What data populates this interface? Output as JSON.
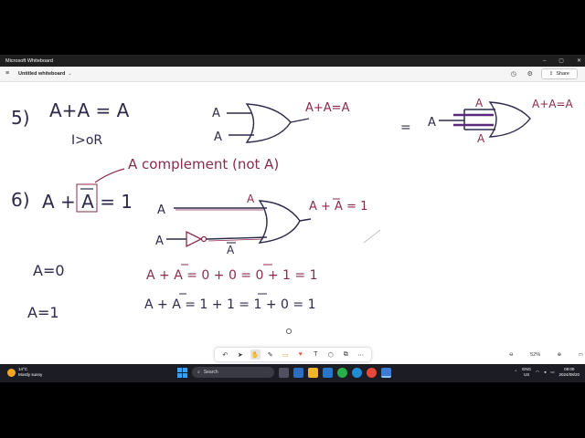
{
  "window": {
    "title": "Microsoft Whiteboard",
    "minimize": "–",
    "maximize": "▢",
    "close": "✕"
  },
  "appbar": {
    "menu": "≡",
    "doc_title": "Untitled whiteboard",
    "chevron": "⌄",
    "history_icon": "◷",
    "settings_icon": "⚙",
    "share_label": "Share",
    "share_icon": "⇪"
  },
  "whiteboard": {
    "eq5_number": "5)",
    "eq5_lhs": "A+A = A",
    "eq5_note": "I>oR",
    "eq5_gate_in1": "A",
    "eq5_gate_in2": "A",
    "eq5_gate_out": "A+A=A",
    "eq5_alt_eq": "=",
    "eq5_alt_in": "A",
    "eq5_alt_in_top": "A",
    "eq5_alt_in_bottom": "A",
    "eq5_alt_out": "A+A=A",
    "complement_note": "A complement (not A)",
    "eq6_number": "6)",
    "eq6_lhs": "A + A = 1",
    "eq6_gate_in1": "A",
    "eq6_gate_in1_label": "A",
    "eq6_gate_in2": "A",
    "eq6_not_label": "A",
    "eq6_gate_out": "A + A = 1",
    "case1_label": "A=0",
    "case1_eq": "A + A = 0 + 0 = 0 + 1 = 1",
    "case2_label": "A=1",
    "case2_eq": "A + A = 1 + 1 = 1 + 0 = 1"
  },
  "toolbar": {
    "undo": "↶",
    "select": "➤",
    "hand": "✋",
    "pen": "✎",
    "notes": "▭",
    "reactions": "♥",
    "text": "T",
    "shapes": "⬡",
    "copy": "⧉",
    "more": "⋯"
  },
  "zoom": {
    "out": "⊖",
    "level": "52%",
    "in": "⊕",
    "fit": "▭"
  },
  "taskbar": {
    "temp": "14°C",
    "weather": "Mostly sunny",
    "search_label": "Search",
    "search_icon": "⌕",
    "lang1": "ENG",
    "lang2": "US",
    "time": "09:00",
    "date": "2024/08/20"
  },
  "colors": {
    "ink_dark": "#2d2a4a",
    "ink_red": "#8a2b4a",
    "ink_purple": "#5b2a7a"
  }
}
